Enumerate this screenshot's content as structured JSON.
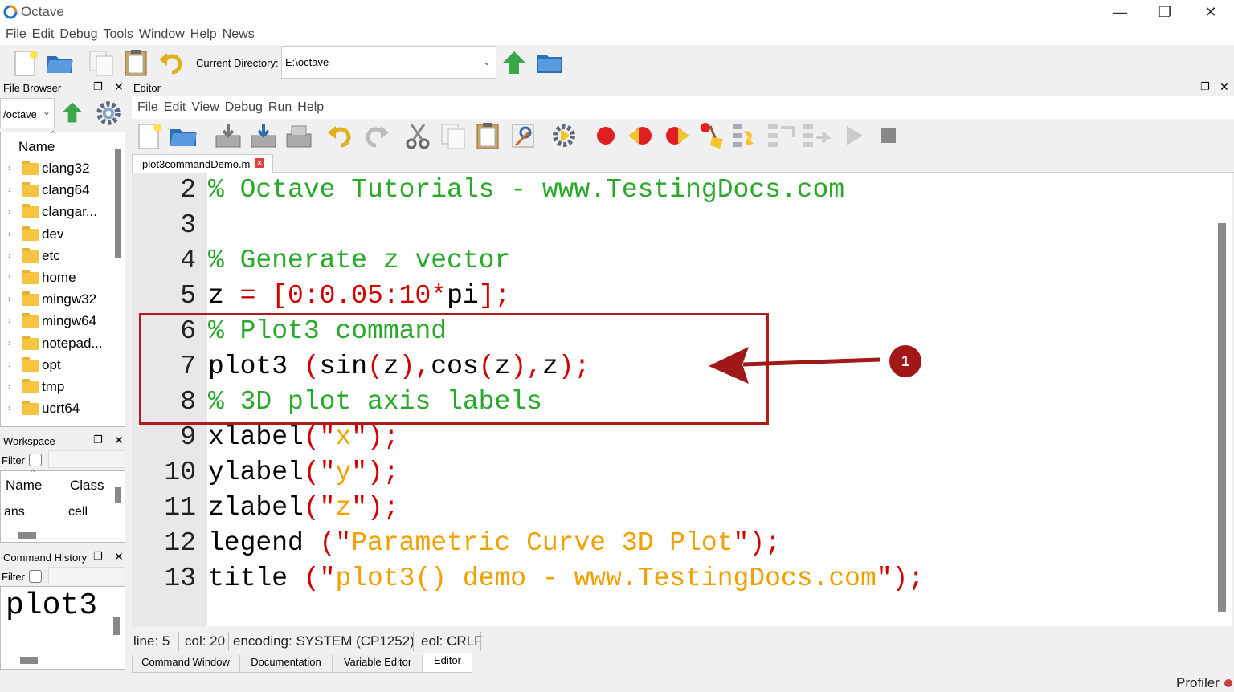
{
  "window": {
    "title": "Octave",
    "controls": {
      "minimize": "—",
      "maximize": "❐",
      "close": "✕"
    }
  },
  "menubar": [
    "File",
    "Edit",
    "Debug",
    "Tools",
    "Window",
    "Help",
    "News"
  ],
  "toolbar": {
    "current_directory_label": "Current Directory:",
    "current_directory_value": "E:\\octave"
  },
  "file_browser": {
    "title": "File Browser",
    "path": "/octave",
    "column_header": "Name",
    "items": [
      "clang32",
      "clang64",
      "clangar...",
      "dev",
      "etc",
      "home",
      "mingw32",
      "mingw64",
      "notepad...",
      "opt",
      "tmp",
      "ucrt64"
    ]
  },
  "workspace": {
    "title": "Workspace",
    "filter_label": "Filter",
    "columns": [
      "Name",
      "Class"
    ],
    "rows": [
      {
        "name": "ans",
        "class": "cell"
      }
    ]
  },
  "command_history": {
    "title": "Command History",
    "filter_label": "Filter",
    "entry": "plot3"
  },
  "editor": {
    "title": "Editor",
    "menu": [
      "File",
      "Edit",
      "View",
      "Debug",
      "Run",
      "Help"
    ],
    "tab_name": "plot3commandDemo.m",
    "lines": [
      {
        "num": "2",
        "parts": [
          {
            "c": "cmt",
            "t": "% Octave Tutorials - www.TestingDocs.com"
          }
        ]
      },
      {
        "num": "3",
        "parts": []
      },
      {
        "num": "4",
        "parts": [
          {
            "c": "cmt",
            "t": "% Generate z vector"
          }
        ]
      },
      {
        "num": "5",
        "parts": [
          {
            "c": "kw",
            "t": "z "
          },
          {
            "c": "op",
            "t": "= [0:0.05:10*"
          },
          {
            "c": "kw",
            "t": "pi"
          },
          {
            "c": "op",
            "t": "];"
          }
        ]
      },
      {
        "num": "6",
        "parts": [
          {
            "c": "cmt",
            "t": "% Plot3 command"
          }
        ]
      },
      {
        "num": "7",
        "parts": [
          {
            "c": "kw",
            "t": "plot3 "
          },
          {
            "c": "op",
            "t": "("
          },
          {
            "c": "kw",
            "t": "sin"
          },
          {
            "c": "op",
            "t": "("
          },
          {
            "c": "kw",
            "t": "z"
          },
          {
            "c": "op",
            "t": "),"
          },
          {
            "c": "kw",
            "t": "cos"
          },
          {
            "c": "op",
            "t": "("
          },
          {
            "c": "kw",
            "t": "z"
          },
          {
            "c": "op",
            "t": "),"
          },
          {
            "c": "kw",
            "t": "z"
          },
          {
            "c": "op",
            "t": ");"
          }
        ]
      },
      {
        "num": "8",
        "parts": [
          {
            "c": "cmt",
            "t": "% 3D plot axis labels"
          }
        ]
      },
      {
        "num": "9",
        "parts": [
          {
            "c": "kw",
            "t": "xlabel"
          },
          {
            "c": "op",
            "t": "(\""
          },
          {
            "c": "str",
            "t": "x"
          },
          {
            "c": "op",
            "t": "\");"
          }
        ]
      },
      {
        "num": "10",
        "parts": [
          {
            "c": "kw",
            "t": "ylabel"
          },
          {
            "c": "op",
            "t": "(\""
          },
          {
            "c": "str",
            "t": "y"
          },
          {
            "c": "op",
            "t": "\");"
          }
        ]
      },
      {
        "num": "11",
        "parts": [
          {
            "c": "kw",
            "t": "zlabel"
          },
          {
            "c": "op",
            "t": "(\""
          },
          {
            "c": "str",
            "t": "z"
          },
          {
            "c": "op",
            "t": "\");"
          }
        ]
      },
      {
        "num": "12",
        "parts": [
          {
            "c": "kw",
            "t": "legend "
          },
          {
            "c": "op",
            "t": "(\""
          },
          {
            "c": "str",
            "t": "Parametric Curve 3D Plot"
          },
          {
            "c": "op",
            "t": "\");"
          }
        ]
      },
      {
        "num": "13",
        "parts": [
          {
            "c": "kw",
            "t": "title "
          },
          {
            "c": "op",
            "t": "(\""
          },
          {
            "c": "str",
            "t": "plot3() demo - www.TestingDocs.com"
          },
          {
            "c": "op",
            "t": "\");"
          }
        ]
      }
    ]
  },
  "annotation": {
    "badge": "1"
  },
  "statusbar": {
    "line": "line: 5",
    "col": "col: 20",
    "encoding": "encoding: SYSTEM (CP1252)",
    "eol": "eol: CRLF"
  },
  "bottom_tabs": [
    "Command Window",
    "Documentation",
    "Variable Editor",
    "Editor"
  ],
  "profiler": "Profiler",
  "colors": {
    "comment": "#2aa82a",
    "operator": "#d00000",
    "string": "#f0a000",
    "highlight_box": "#b01c1c"
  }
}
